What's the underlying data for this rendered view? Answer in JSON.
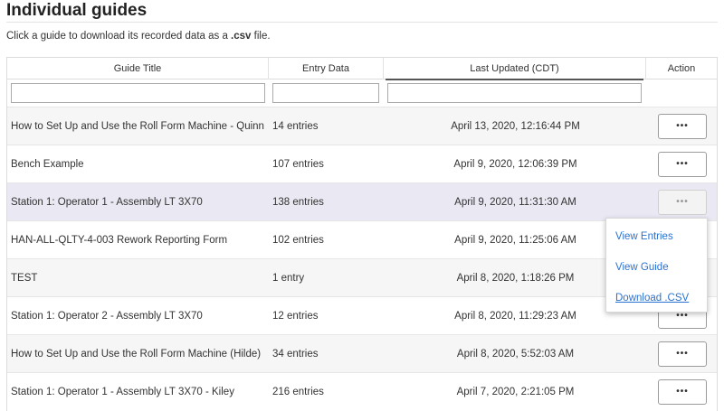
{
  "header": {
    "title": "Individual guides",
    "subtitle_pre": "Click a guide to download its recorded data as a ",
    "subtitle_bold": ".csv",
    "subtitle_post": " file."
  },
  "table": {
    "columns": [
      {
        "label": "Guide Title"
      },
      {
        "label": "Entry Data"
      },
      {
        "label": "Last Updated (CDT)",
        "sorted": true
      },
      {
        "label": "Action"
      }
    ],
    "filters": {
      "title": "",
      "entry": "",
      "updated": ""
    },
    "rows": [
      {
        "title": "How to Set Up and Use the Roll Form Machine - Quinn",
        "entries": "14 entries",
        "updated": "April 13, 2020, 12:16:44 PM"
      },
      {
        "title": "Bench Example",
        "entries": "107 entries",
        "updated": "April 9, 2020, 12:06:39 PM"
      },
      {
        "title": "Station 1: Operator 1 - Assembly LT 3X70",
        "entries": "138 entries",
        "updated": "April 9, 2020, 11:31:30 AM"
      },
      {
        "title": "HAN-ALL-QLTY-4-003 Rework Reporting Form",
        "entries": "102 entries",
        "updated": "April 9, 2020, 11:25:06 AM"
      },
      {
        "title": "TEST",
        "entries": "1 entry",
        "updated": "April 8, 2020, 1:18:26 PM"
      },
      {
        "title": "Station 1: Operator 2 - Assembly LT 3X70",
        "entries": "12 entries",
        "updated": "April 8, 2020, 11:29:23 AM"
      },
      {
        "title": "How to Set Up and Use the Roll Form Machine (Hilde)",
        "entries": "34 entries",
        "updated": "April 8, 2020, 5:52:03 AM"
      },
      {
        "title": "Station 1: Operator 1 - Assembly LT 3X70 - Kiley",
        "entries": "216 entries",
        "updated": "April 7, 2020, 2:21:05 PM"
      }
    ],
    "action_glyph": "•••"
  },
  "action_menu": {
    "items": [
      "View Entries",
      "View Guide",
      "Download .CSV"
    ]
  },
  "colors": {
    "link": "#2a72d0",
    "row_highlight": "#e9e8f3"
  }
}
